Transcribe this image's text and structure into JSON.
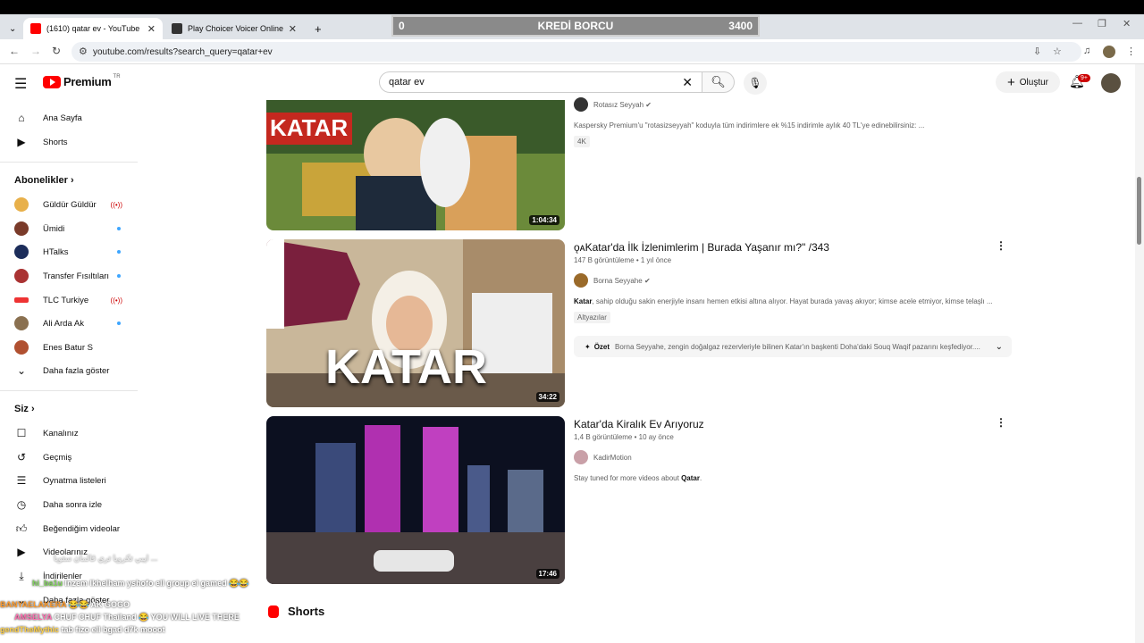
{
  "browser": {
    "tabs": [
      {
        "label": "(1610) qatar ev - YouTube",
        "active": true
      },
      {
        "label": "Play Choicer Voicer Online Free",
        "active": false
      }
    ],
    "new_tab": "+",
    "url": "youtube.com/results?search_query=qatar+ev"
  },
  "overlay": {
    "left_value": "0",
    "title": "KREDİ BORCU",
    "right_value": "3400"
  },
  "header": {
    "logo_text": "Premium",
    "logo_region": "TR",
    "search_value": "qatar ev",
    "create_label": "Oluştur",
    "notifications_badge": "9+"
  },
  "sidebar": {
    "main": [
      {
        "label": "Ana Sayfa",
        "icon": "home-icon"
      },
      {
        "label": "Shorts",
        "icon": "shorts-icon"
      }
    ],
    "subscriptions_title": "Abonelikler",
    "subscriptions": [
      {
        "label": "Güldür Güldür",
        "status": "live"
      },
      {
        "label": "Ümidi",
        "status": "new"
      },
      {
        "label": "HTalks",
        "status": "new"
      },
      {
        "label": "Transfer Fısıltıları",
        "status": "new"
      },
      {
        "label": "TLC Turkiye",
        "status": "live"
      },
      {
        "label": "Ali Arda Ak",
        "status": "new"
      },
      {
        "label": "Enes Batur S",
        "status": ""
      }
    ],
    "show_more": "Daha fazla göster",
    "you_title": "Siz",
    "you_items": [
      {
        "label": "Kanalınız",
        "icon": "channel-icon"
      },
      {
        "label": "Geçmiş",
        "icon": "history-icon"
      },
      {
        "label": "Oynatma listeleri",
        "icon": "playlist-icon"
      },
      {
        "label": "Daha sonra izle",
        "icon": "clock-icon"
      },
      {
        "label": "Beğendiğim videolar",
        "icon": "thumbs-up-icon"
      },
      {
        "label": "Videolarınız",
        "icon": "video-icon"
      },
      {
        "label": "İndirilenler",
        "icon": "download-icon"
      },
      {
        "label": "Daha fazla göster",
        "icon": "chevron-down-icon"
      }
    ]
  },
  "results": [
    {
      "thumb_text": "KATAR",
      "duration": "1:04:34",
      "channel": "Rotasız Seyyah",
      "description": "Kaspersky Premium'u \"rotasizseyyah\" koduyla tüm indirimlere ek %15 indirimle aylık 40 TL'ye edinebilirsiniz: ...",
      "chip": "4K"
    },
    {
      "thumb_text": "KATAR",
      "duration": "34:22",
      "title": "ǫᴀKatar'da İlk İzlenimlerim | Burada Yaşanır mı?\" /343",
      "views": "147 B görüntüleme",
      "age": "1 yıl önce",
      "channel": "Borna Seyyahe",
      "description_bold": "Katar",
      "description": ", sahip olduğu sakin enerjiyle insanı hemen etkisi altına alıyor. Hayat burada yavaş akıyor; kimse acele etmiyor, kimse telaşlı ...",
      "chip": "Altyazılar",
      "summary_label": "Özet",
      "summary": "Borna Seyyahe, zengin doğalgaz rezervleriyle bilinen Katar'ın başkenti Doha'daki Souq Waqif pazarını keşfediyor...."
    },
    {
      "duration": "17:46",
      "title": "Katar'da Kiralık Ev Arıyoruz",
      "views": "1,4 B görüntüleme",
      "age": "10 ay önce",
      "channel": "KadirMotion",
      "description": "Stay tuned for more videos about ",
      "description_bold": "Qatar",
      "description_end": "."
    }
  ],
  "shorts_label": "Shorts",
  "chat": [
    {
      "user": "",
      "text": "ايبي تكرويا تري قالمان ستوبا ...",
      "color": "#cccccc"
    },
    {
      "user": "hi_ba1u",
      "text": "Inzem Ikhelham yshofo ell group el gamed 😂😂",
      "color": "#7fd35a"
    },
    {
      "user": "BANYAELAKERA",
      "text": "😂😂 AK GOGO",
      "color": "#ff9a2a"
    },
    {
      "user": "AMSELYA",
      "text": "CHUF CHUF Thailand 😂 YOU WILL LIVE THERE",
      "color": "#ff6fb0"
    },
    {
      "user": "gendTheMythic",
      "text": "tab fizo ell bgad d7k mooot",
      "color": "#ffd24a"
    }
  ]
}
